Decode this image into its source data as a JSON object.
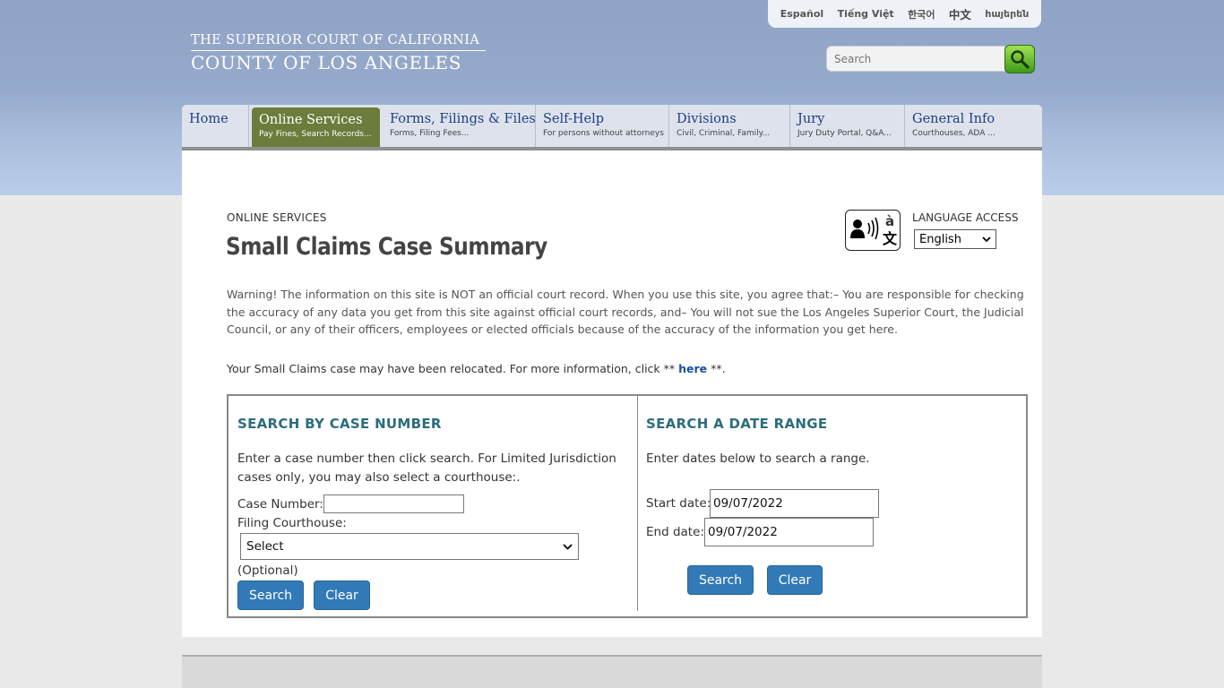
{
  "header": {
    "logo_line1": "THE SUPERIOR COURT OF CALIFORNIA",
    "logo_line2": "COUNTY OF LOS ANGELES",
    "languages": [
      "Español",
      "Tiếng Việt",
      "한국어",
      "中文",
      "հայերեն"
    ],
    "search_placeholder": "Search"
  },
  "nav": [
    {
      "title": "Home",
      "sub": ""
    },
    {
      "title": "Online Services",
      "sub": "Pay Fines, Search Records..."
    },
    {
      "title": "Forms, Filings & Files",
      "sub": "Forms, Filing Fees..."
    },
    {
      "title": "Self-Help",
      "sub": "For persons without attorneys"
    },
    {
      "title": "Divisions",
      "sub": "Civil, Criminal, Family..."
    },
    {
      "title": "Jury",
      "sub": "Jury Duty Portal, Q&A..."
    },
    {
      "title": "General Info",
      "sub": "Courthouses, ADA ..."
    }
  ],
  "page": {
    "breadcrumb": "ONLINE SERVICES",
    "title": "Small Claims Case Summary",
    "language_access_label": "LANGUAGE ACCESS",
    "language_selected": "English",
    "warning": "Warning! The information on this site is NOT an official court record. When you use this site, you agree that:– You are responsible for checking the accuracy of any data you get from this site against official court records, and– You will not sue the Los Angeles Superior Court, the Judicial Council, or any of their officers, employees or elected officials because of the accuracy of the information you get here.",
    "relocated_prefix": "Your Small Claims case may have been relocated. For more information, click ** ",
    "relocated_link": "here",
    "relocated_suffix": " **."
  },
  "case_search": {
    "heading": "SEARCH BY CASE NUMBER",
    "instructions": "Enter a case number then click search. For Limited Jurisdiction cases only, you may also select a courthouse:.",
    "case_number_label": "Case Number:",
    "case_number_value": "",
    "courthouse_label": "Filing Courthouse:",
    "courthouse_selected": "Select",
    "optional_label": "(Optional)",
    "search_label": "Search",
    "clear_label": "Clear"
  },
  "date_search": {
    "heading": "SEARCH A DATE RANGE",
    "instructions": "Enter dates below to search a range.",
    "start_label": "Start date:",
    "start_value": "09/07/2022",
    "end_label": "End date:",
    "end_value": "09/07/2022",
    "search_label": "Search",
    "clear_label": "Clear"
  }
}
